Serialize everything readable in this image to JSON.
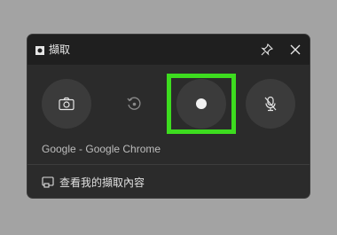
{
  "window": {
    "title": "擷取"
  },
  "source": {
    "label": "Google - Google Chrome"
  },
  "footer": {
    "gallery_link": "查看我的擷取內容"
  },
  "colors": {
    "highlight": "#3ddc1f",
    "panel": "#2b2b2b",
    "titlebar": "#1f1f1f"
  },
  "icons": [
    "capture-app-icon",
    "pin-icon",
    "close-icon",
    "camera-icon",
    "record-last-30s-icon",
    "record-icon",
    "mic-off-icon",
    "gallery-icon"
  ]
}
